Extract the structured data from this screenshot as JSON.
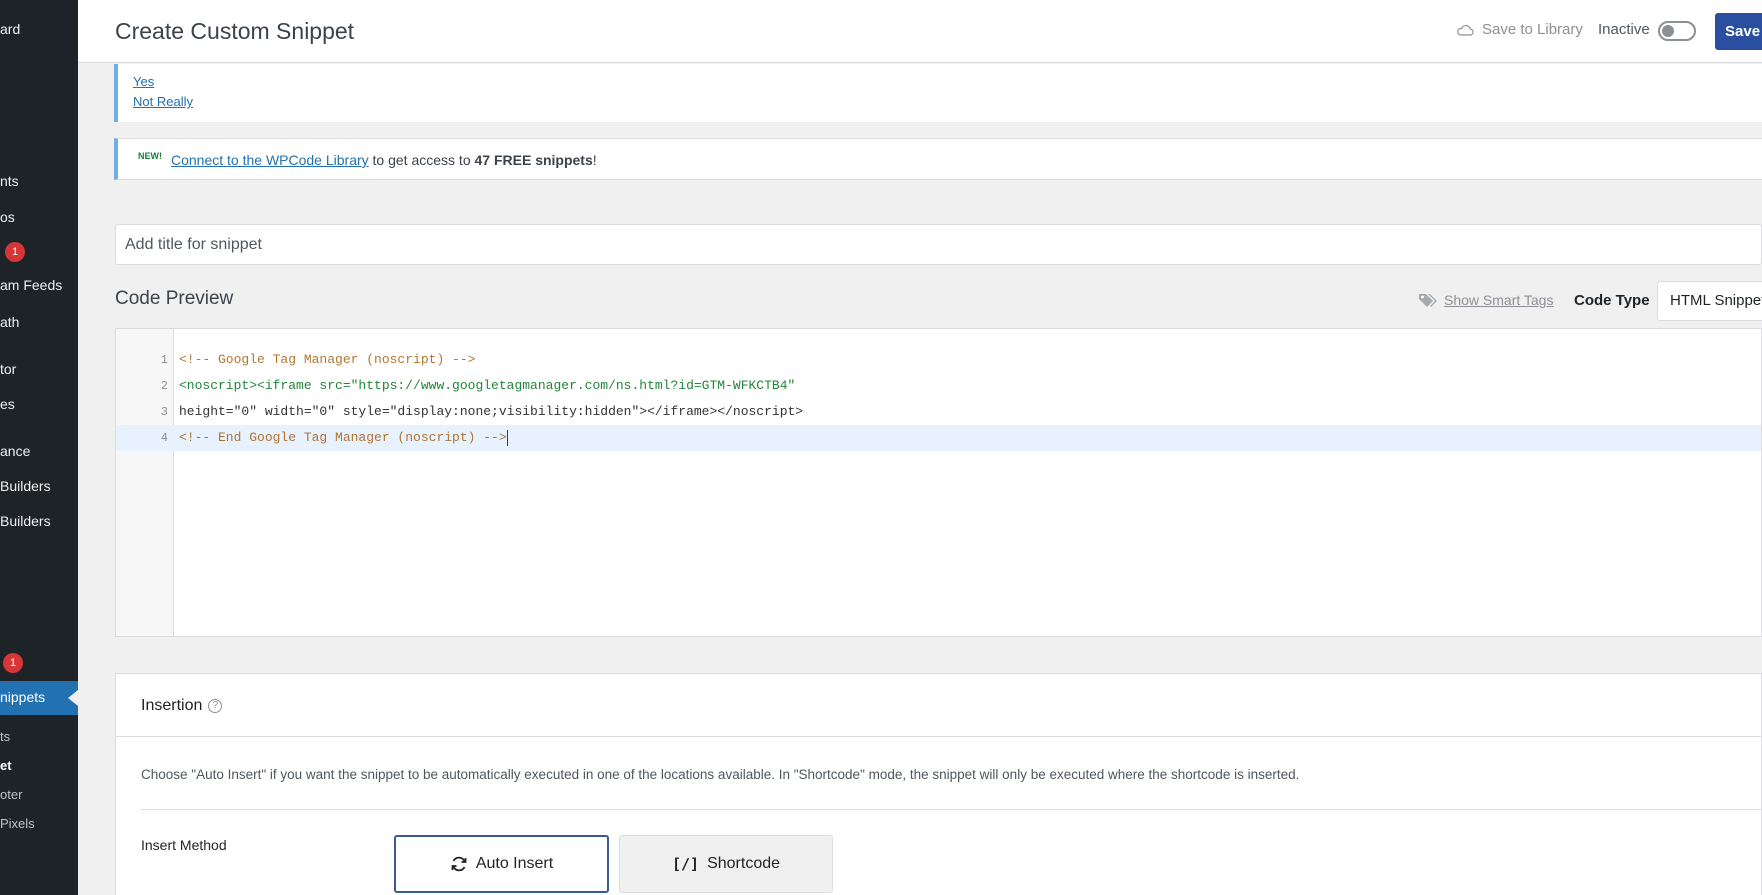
{
  "sidebar": {
    "items": [
      {
        "label": "ard"
      },
      {
        "label": "nts"
      },
      {
        "label": "os"
      },
      {
        "label": "1"
      },
      {
        "label": "am Feeds"
      },
      {
        "label": "ath"
      },
      {
        "label": "tor"
      },
      {
        "label": "es"
      },
      {
        "label": "ance"
      },
      {
        "label": "Builders"
      },
      {
        "label": "Builders"
      },
      {
        "label": "1"
      }
    ],
    "active_label": "nippets",
    "sub_items": [
      {
        "label": "ts"
      },
      {
        "label": "et"
      },
      {
        "label": "oter"
      },
      {
        "label": "Pixels"
      }
    ]
  },
  "header": {
    "title": "Create Custom Snippet",
    "save_to_library": "Save to Library",
    "status_label": "Inactive",
    "save_label": "Save"
  },
  "feedback_notice": {
    "yes": "Yes",
    "not_really": "Not Really"
  },
  "library_notice": {
    "new_badge": "NEW!",
    "link": "Connect to the WPCode Library",
    "text_mid": " to get access to ",
    "count": "47 FREE snippets",
    "text_end": "!"
  },
  "snippet_title": {
    "placeholder": "Add title for snippet",
    "value": ""
  },
  "code_preview": {
    "title": "Code Preview",
    "smart_tags": "Show Smart Tags",
    "code_type_label": "Code Type",
    "code_type_value": "HTML Snippet",
    "lines": [
      {
        "n": "1",
        "text": "<!-- Google Tag Manager (noscript) -->"
      },
      {
        "n": "2",
        "text": "<noscript><iframe src=\"https://www.googletagmanager.com/ns.html?id=GTM-WFKCTB4\""
      },
      {
        "n": "3",
        "text": "height=\"0\" width=\"0\" style=\"display:none;visibility:hidden\"></iframe></noscript>"
      },
      {
        "n": "4",
        "text": "<!-- End Google Tag Manager (noscript) -->"
      }
    ]
  },
  "insertion": {
    "title": "Insertion",
    "description": "Choose \"Auto Insert\" if you want the snippet to be automatically executed in one of the locations available. In \"Shortcode\" mode, the snippet will only be executed where the shortcode is inserted.",
    "method_label": "Insert Method",
    "auto_insert": "Auto Insert",
    "shortcode": "Shortcode",
    "shortcode_icon": "[/]"
  },
  "colors": {
    "sidebar_bg": "#1d2327",
    "active_blue": "#2271b1",
    "save_button": "#2b4fa0",
    "badge_red": "#d63638"
  }
}
